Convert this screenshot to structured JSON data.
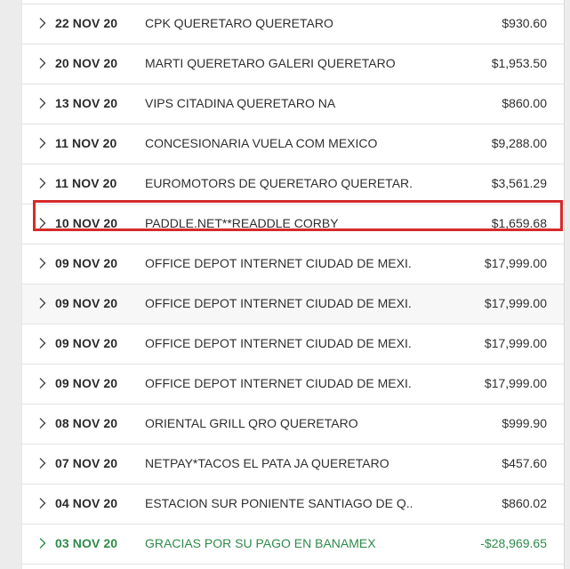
{
  "colors": {
    "background": "#ececec",
    "panel": "#ffffff",
    "text": "#2f2f2f",
    "credit_text": "#2e8a4a",
    "highlight_border": "#d62b2b",
    "divider": "#e2e2e2"
  },
  "transactions": [
    {
      "date": "22 NOV 20",
      "description": "CPK QUERETARO QUERETARO",
      "amount": "$930.60",
      "alt": false,
      "selected": false,
      "credit": false
    },
    {
      "date": "20 NOV 20",
      "description": "MARTI QUERETARO GALERI QUERETARO",
      "amount": "$1,953.50",
      "alt": false,
      "selected": false,
      "credit": false
    },
    {
      "date": "13 NOV 20",
      "description": "VIPS CITADINA QUERETARO NA",
      "amount": "$860.00",
      "alt": false,
      "selected": false,
      "credit": false
    },
    {
      "date": "11 NOV 20",
      "description": "CONCESIONARIA VUELA COM MEXICO",
      "amount": "$9,288.00",
      "alt": false,
      "selected": false,
      "credit": false
    },
    {
      "date": "11 NOV 20",
      "description": "EUROMOTORS DE QUERETARO QUERETAR...",
      "amount": "$3,561.29",
      "alt": false,
      "selected": false,
      "credit": false
    },
    {
      "date": "10 NOV 20",
      "description": "PADDLE.NET**READDLE CORBY",
      "amount": "$1,659.68",
      "alt": false,
      "selected": true,
      "credit": false
    },
    {
      "date": "09 NOV 20",
      "description": "OFFICE DEPOT INTERNET CIUDAD DE MEXI...",
      "amount": "$17,999.00",
      "alt": false,
      "selected": false,
      "credit": false
    },
    {
      "date": "09 NOV 20",
      "description": "OFFICE DEPOT INTERNET CIUDAD DE MEXI...",
      "amount": "$17,999.00",
      "alt": true,
      "selected": false,
      "credit": false
    },
    {
      "date": "09 NOV 20",
      "description": "OFFICE DEPOT INTERNET CIUDAD DE MEXI...",
      "amount": "$17,999.00",
      "alt": false,
      "selected": false,
      "credit": false
    },
    {
      "date": "09 NOV 20",
      "description": "OFFICE DEPOT INTERNET CIUDAD DE MEXI...",
      "amount": "$17,999.00",
      "alt": false,
      "selected": false,
      "credit": false
    },
    {
      "date": "08 NOV 20",
      "description": "ORIENTAL GRILL QRO QUERETARO",
      "amount": "$999.90",
      "alt": false,
      "selected": false,
      "credit": false
    },
    {
      "date": "07 NOV 20",
      "description": "NETPAY*TACOS EL PATA JA QUERETARO",
      "amount": "$457.60",
      "alt": false,
      "selected": false,
      "credit": false
    },
    {
      "date": "04 NOV 20",
      "description": "ESTACION SUR PONIENTE SANTIAGO DE Q...",
      "amount": "$860.02",
      "alt": false,
      "selected": false,
      "credit": false
    },
    {
      "date": "03 NOV 20",
      "description": "GRACIAS POR SU PAGO EN BANAMEX",
      "amount": "-$28,969.65",
      "alt": false,
      "selected": false,
      "credit": true
    }
  ],
  "icons": {
    "row_expand": "chevron-right-icon"
  }
}
